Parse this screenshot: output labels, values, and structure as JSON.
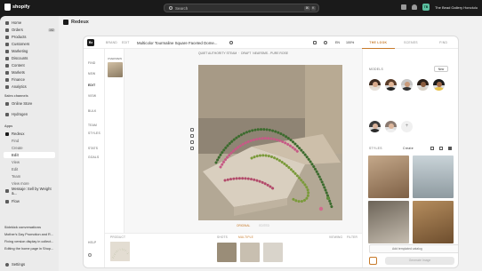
{
  "topbar": {
    "brand": "shopify",
    "search_placeholder": "Search",
    "shortcut_keys": [
      "⌘",
      "K"
    ],
    "store_name": "The Bead Gallery Honolulu",
    "avatar_initials": "TB"
  },
  "sidebar": {
    "items": [
      {
        "label": "Home"
      },
      {
        "label": "Orders",
        "badge": "152"
      },
      {
        "label": "Products"
      },
      {
        "label": "Customers"
      },
      {
        "label": "Marketing"
      },
      {
        "label": "Discounts"
      },
      {
        "label": "Content"
      },
      {
        "label": "Markets"
      },
      {
        "label": "Finance"
      },
      {
        "label": "Analytics"
      }
    ],
    "sales_channels_title": "Sales channels",
    "online_store": "Online Store",
    "hydrogen": "Hydrogen",
    "apps_title": "Apps",
    "redeux": "Redeux",
    "redeux_subs": [
      "Find",
      "Create",
      "Edit",
      "View",
      "Edit",
      "Team",
      "View more"
    ],
    "messaging": "Messaje: Sell by Weight &...",
    "flow": "Flow",
    "conversations_title": "Sidekick conversations",
    "conversations": [
      "Mother's Day Promotion and R...",
      "Fixing version display in collect...",
      "Editing the home page in Shop..."
    ],
    "settings": "Settings"
  },
  "page": {
    "app_name": "Redeux"
  },
  "editor": {
    "logo": "Rz",
    "crumbs": [
      "BRAND",
      "EDIT"
    ],
    "title": "Multicolor Tourmaline Square Faceted Dome...",
    "lang": "EN",
    "zoom": "100%",
    "tabs": [
      "THE LOOK",
      "SCENES",
      "FIND"
    ],
    "active_tab": "THE LOOK",
    "rail": [
      "FIND",
      "NEW",
      "EDIT",
      "VIEW",
      "BULK",
      "TEAM",
      "STYLES",
      "STATS",
      "GOALS"
    ],
    "help": "HELP",
    "overview_label": "OVERVIEW",
    "canvas_head_left": "QUIET AUTHORITY STEAM",
    "canvas_head_mid": "DRAFT",
    "canvas_head_right": "NEARSMS - PURE ROSE",
    "canvas_buttons": [
      "ORIGINAL",
      "EDITED"
    ],
    "product_label": "PRODUCT",
    "shots_label": "SHOTS",
    "shots_tag": "MULTIPLE",
    "bottom_right_label": "VIEWING",
    "bottom_right_tag": "FILTER",
    "models_label": "MODELS",
    "new_button": "New",
    "styles_label": "STYLES",
    "styles_create": "Create",
    "add_template": "Add templated catalog",
    "generate": "Generate Image"
  },
  "colors": {
    "accent": "#c77a2a",
    "topbar": "#1a1a1a",
    "sidebar": "#ebebeb"
  }
}
